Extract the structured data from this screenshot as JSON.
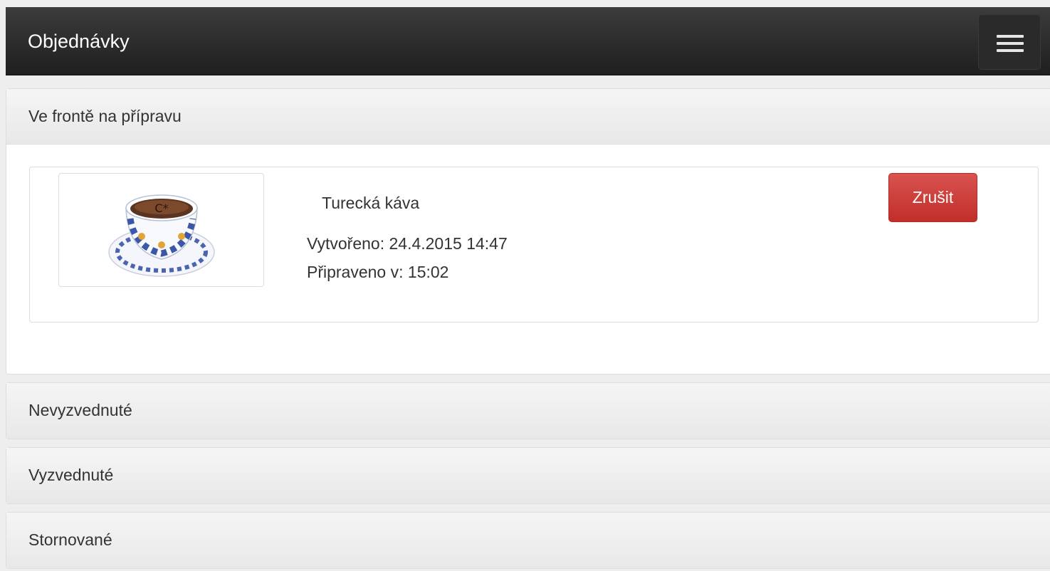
{
  "navbar": {
    "title": "Objednávky",
    "menu_icon": "hamburger-menu-icon"
  },
  "sections": [
    {
      "title": "Ve frontě na přípravu",
      "expanded": true,
      "orders": [
        {
          "product": "Turecká káva",
          "created_label": "Vytvořeno:",
          "created_value": "24.4.2015 14:47",
          "ready_label": "Připraveno v:",
          "ready_value": "15:02",
          "cancel_label": "Zrušit"
        }
      ]
    },
    {
      "title": "Nevyzvednuté",
      "expanded": false
    },
    {
      "title": "Vyzvednuté",
      "expanded": false
    },
    {
      "title": "Stornované",
      "expanded": false
    }
  ],
  "colors": {
    "navbar": "#2b2b2b",
    "danger": "#d43f3a",
    "panel_heading": "#efefef"
  }
}
